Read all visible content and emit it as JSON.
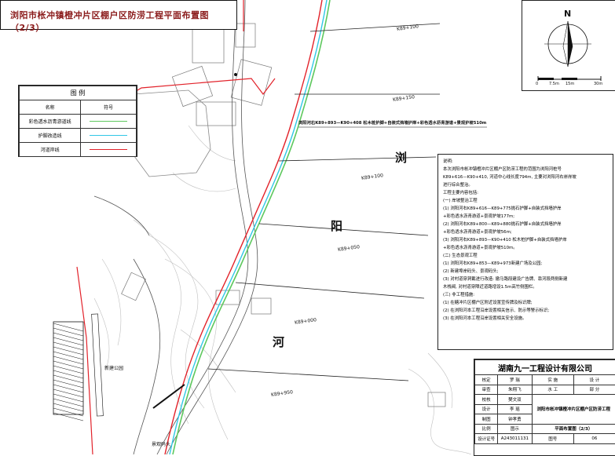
{
  "title": "浏阳市枨冲镇橙冲片区棚户区防涝工程平面布置图（2/3）",
  "legend": {
    "heading": "图 例",
    "col_name": "名称",
    "col_symbol": "符号",
    "items": [
      {
        "name": "彩色透水沥青游道线",
        "color": "#5ec85e"
      },
      {
        "name": "护脚改造线",
        "color": "#31c7e6"
      },
      {
        "name": "河道岸线",
        "color": "#e2222a"
      }
    ]
  },
  "river_chars": [
    "浏",
    "阳",
    "河"
  ],
  "chainages": [
    "K89+100",
    "K89+150",
    "K89+100",
    "K89+050",
    "K89+000",
    "K89+950"
  ],
  "project_label": "浏阳河右K89+893—K90+408 松木桩护脚+自装式挡墙护岸+彩色透水沥青游道+景观护坡510m",
  "map_labels": {
    "park": "新建公园",
    "dock": "景观码头"
  },
  "compass": {
    "north": "N",
    "scale_ticks": [
      "0",
      "7.5m",
      "15m",
      "30m"
    ]
  },
  "notes": [
    "说明:",
    "    本次浏阳市枨冲镇橙冲片区棚户区防涝工程的范围为浏阳河桩号",
    "K89+616—K90+410, 河道中心线长度794m, 主要对浏阳河右岸岸坡",
    "进行综合整治。",
    "    工程主要内容包括:",
    "    (一) 岸坡整治工程",
    "    (1) 浏阳河右K89+616—K89+775抛石护脚+自装式挡墙护岸",
    "+彩色透水沥青游道+景观护坡177m;",
    "    (2) 浏阳河右K89+800—K89+880抛石护脚+自装式挡墙护岸",
    "+彩色透水沥青游道+景观护坡56m;",
    "    (3) 浏阳河右K89+893—K90+410 松木桩护脚+自装式挡墙护岸",
    "+彩色透水沥青游道+景观护坡510m。",
    "    (二) 生态景观工程",
    "    (1) 浏阳河右K89+853—K89+973新建广场及公园;",
    "    (2) 新建埠岸码头、景观码头;",
    "    (3) 对村道穿洞截进行改造: 撤马路段建设广告牌、靠河段两侧新建",
    "木栈阀, 对村道穿障近道路增设1.5m高竹侧围栏。",
    "    (三) 非工程措施:",
    "    (1) 在糖冲片区棚户区附近设置宣传牌及标识牌;",
    "    (2) 在浏阳河本工程沿岸设置相关信示、防示等警示标识;",
    "    (3) 在浏阳河本工程沿岸设置相关安全设施。"
  ],
  "title_block": {
    "company": "湖南九一工程设计有限公司",
    "rows": [
      {
        "role": "核定",
        "person": "罗 瑞",
        "k": "实 施",
        "v": "设 计"
      },
      {
        "role": "审查",
        "person": "朱翔飞",
        "k": "水 工",
        "v": "部 分"
      },
      {
        "role": "校核",
        "person": "樊文双",
        "k": "",
        "v": ""
      },
      {
        "role": "设计",
        "person": "李 瑶",
        "k": "",
        "v": ""
      },
      {
        "role": "制图",
        "person": "钟孝勇",
        "k": "",
        "v": ""
      }
    ],
    "project": "浏阳市枨冲镇橙冲片区棚户区防涝工程",
    "scale_label": "比例",
    "scale_value": "图示",
    "drawing_name": "平面布置图（2/3）",
    "design_no_label": "设计证号",
    "design_no": "A243011131",
    "sheet_label": "图号",
    "sheet_no": "06"
  }
}
